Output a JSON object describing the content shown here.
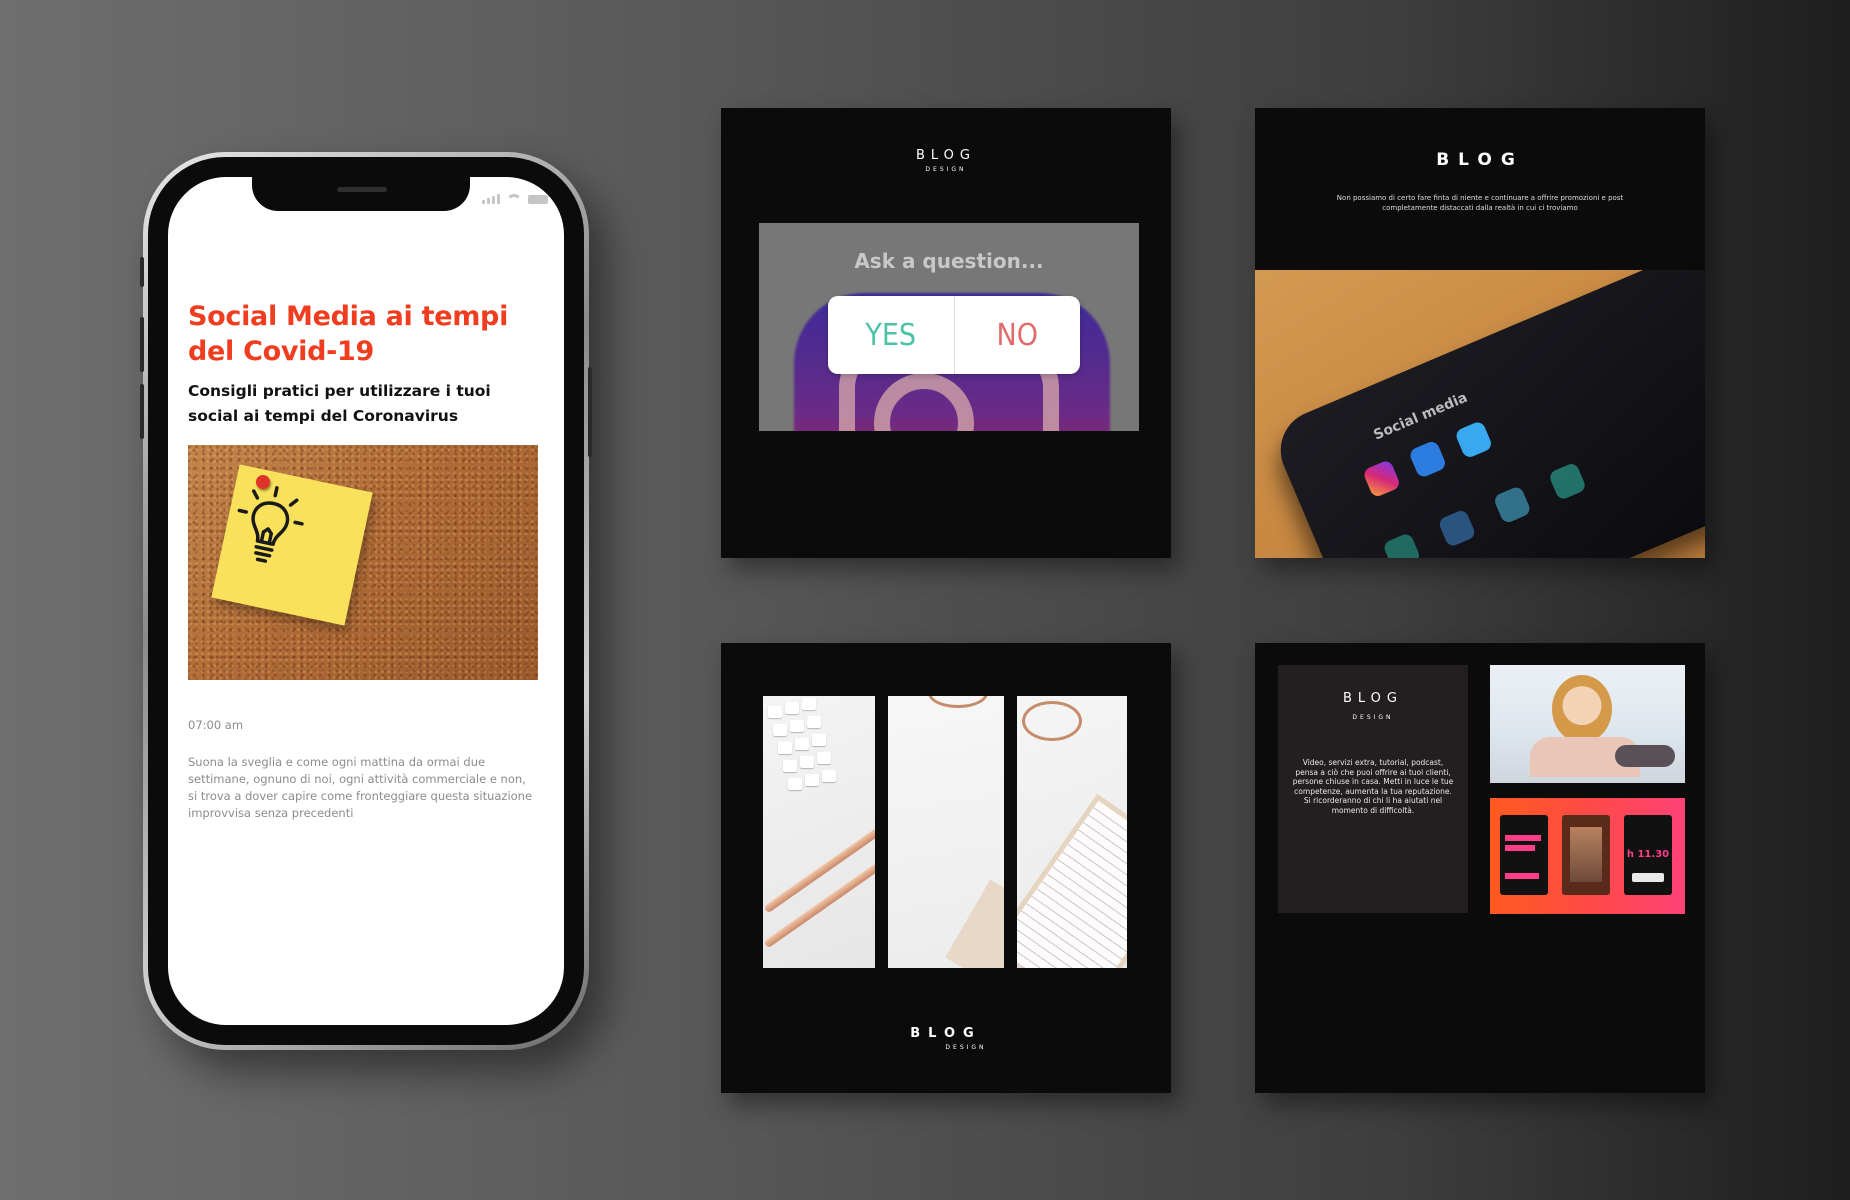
{
  "phone": {
    "post": {
      "title": "Social Media ai tempi del Covid-19",
      "subtitle": "Consigli pratici per utilizzare i tuoi social ai tempi del Coronavirus",
      "time": "07:00 am",
      "body": "Suona la sveglia e come ogni mattina da ormai due settimane, ognuno di noi, ogni attività commerciale e non, si trova a dover capire come fronteggiare questa situazione improvvisa senza precedenti"
    }
  },
  "cards": {
    "card1": {
      "logo_main": "BLOG",
      "logo_sub": "DESIGN",
      "ask": "Ask a question...",
      "poll_yes": "YES",
      "poll_no": "NO"
    },
    "card2": {
      "logo_main": "BLOG",
      "text": "Non possiamo di certo fare finta di niente e continuare a offrire promozioni e post completamente distaccati dalla realtà in cui ci troviamo",
      "photo_label": "Social media",
      "apps": [
        "Instagram",
        "Facebook",
        "Twitter"
      ]
    },
    "card3": {
      "logo_main": "BLOG",
      "logo_sub": "DESIGN"
    },
    "card4": {
      "logo_main": "BLOG",
      "logo_sub": "DESIGN",
      "text": "Video, servizi extra, tutorial, podcast, pensa a ciò che puoi offrire ai tuoi clienti, persone chiuse in casa. Metti in luce le tue competenze, aumenta la tua reputazione. Si ricorderanno di chi li ha aiutati nel momento di difficoltà.",
      "story_time": "h 11.30"
    }
  },
  "colors": {
    "title_red": "#f03c1f",
    "card_bg": "#0b0b0b",
    "poll_yes": "#4cc3a8",
    "poll_no": "#e26a6a",
    "promo_gradient_start": "#ff5a1f",
    "promo_gradient_end": "#ff4276"
  }
}
